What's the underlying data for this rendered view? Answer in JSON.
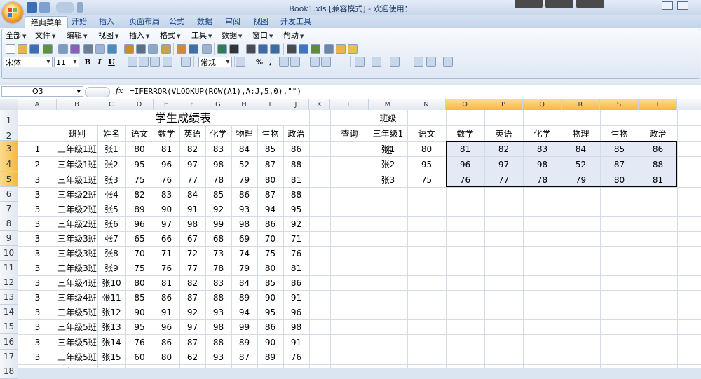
{
  "window": {
    "title": "Book1.xls  [兼容模式] - 欢迎使用："
  },
  "ribbon_tabs": [
    "经典菜单",
    "开始",
    "插入",
    "页面布局",
    "公式",
    "数据",
    "审阅",
    "视图",
    "开发工具"
  ],
  "menus": [
    "全部",
    "文件",
    "编辑",
    "视图",
    "插入",
    "格式",
    "工具",
    "数据",
    "窗口",
    "帮助"
  ],
  "toolbar": {
    "font_name": "宋体",
    "font_size": "11",
    "bold": "B",
    "italic": "I",
    "underline": "U",
    "number_format": "常规",
    "percent": "%",
    "comma": ","
  },
  "formula_bar": {
    "name_box": "O3",
    "fx": "fx",
    "formula": "=IFERROR(VLOOKUP(ROW(A1),A:J,5,0),\"\")"
  },
  "columns": [
    "A",
    "B",
    "C",
    "D",
    "E",
    "F",
    "G",
    "H",
    "I",
    "J",
    "K",
    "L",
    "M",
    "N",
    "O",
    "P",
    "Q",
    "R",
    "S",
    "T"
  ],
  "rows": [
    "1",
    "2",
    "3",
    "4",
    "5",
    "6",
    "7",
    "8",
    "9",
    "10",
    "11",
    "12",
    "13",
    "14",
    "15",
    "16",
    "17",
    "18"
  ],
  "sheet": {
    "title": "学生成绩表",
    "headers": [
      "班别",
      "姓名",
      "语文",
      "数学",
      "英语",
      "化学",
      "物理",
      "生物",
      "政治"
    ],
    "data": [
      [
        "1",
        "三年级1班",
        "张1",
        "80",
        "81",
        "82",
        "83",
        "84",
        "85",
        "86"
      ],
      [
        "2",
        "三年级1班",
        "张2",
        "95",
        "96",
        "97",
        "98",
        "52",
        "87",
        "88"
      ],
      [
        "3",
        "三年级1班",
        "张3",
        "75",
        "76",
        "77",
        "78",
        "79",
        "80",
        "81"
      ],
      [
        "3",
        "三年级2班",
        "张4",
        "82",
        "83",
        "84",
        "85",
        "86",
        "87",
        "88"
      ],
      [
        "3",
        "三年级2班",
        "张5",
        "89",
        "90",
        "91",
        "92",
        "93",
        "94",
        "95"
      ],
      [
        "3",
        "三年级2班",
        "张6",
        "96",
        "97",
        "98",
        "99",
        "98",
        "86",
        "92"
      ],
      [
        "3",
        "三年级3班",
        "张7",
        "65",
        "66",
        "67",
        "68",
        "69",
        "70",
        "71"
      ],
      [
        "3",
        "三年级3班",
        "张8",
        "70",
        "71",
        "72",
        "73",
        "74",
        "75",
        "76"
      ],
      [
        "3",
        "三年级3班",
        "张9",
        "75",
        "76",
        "77",
        "78",
        "79",
        "80",
        "81"
      ],
      [
        "3",
        "三年级4班",
        "张10",
        "80",
        "81",
        "82",
        "83",
        "84",
        "85",
        "86"
      ],
      [
        "3",
        "三年级4班",
        "张11",
        "85",
        "86",
        "87",
        "88",
        "89",
        "90",
        "91"
      ],
      [
        "3",
        "三年级5班",
        "张12",
        "90",
        "91",
        "92",
        "93",
        "94",
        "95",
        "96"
      ],
      [
        "3",
        "三年级5班",
        "张13",
        "95",
        "96",
        "97",
        "98",
        "99",
        "86",
        "98"
      ],
      [
        "3",
        "三年级5班",
        "张14",
        "76",
        "86",
        "87",
        "88",
        "89",
        "90",
        "91"
      ],
      [
        "3",
        "三年级5班",
        "张15",
        "60",
        "80",
        "62",
        "93",
        "87",
        "89",
        "76"
      ],
      [
        "3",
        "三年级6班",
        "张16",
        "89",
        "90",
        "91",
        "92",
        "93",
        "94",
        "95"
      ]
    ]
  },
  "lookup": {
    "class_label": "班级",
    "query_label": "查询",
    "class_value": "三年级1班",
    "headers": [
      "语文",
      "数学",
      "英语",
      "化学",
      "物理",
      "生物",
      "政治"
    ],
    "rows": [
      [
        "张1",
        "80",
        "81",
        "82",
        "83",
        "84",
        "85",
        "86"
      ],
      [
        "张2",
        "95",
        "96",
        "97",
        "98",
        "52",
        "87",
        "88"
      ],
      [
        "张3",
        "75",
        "76",
        "77",
        "78",
        "79",
        "80",
        "81"
      ]
    ]
  }
}
